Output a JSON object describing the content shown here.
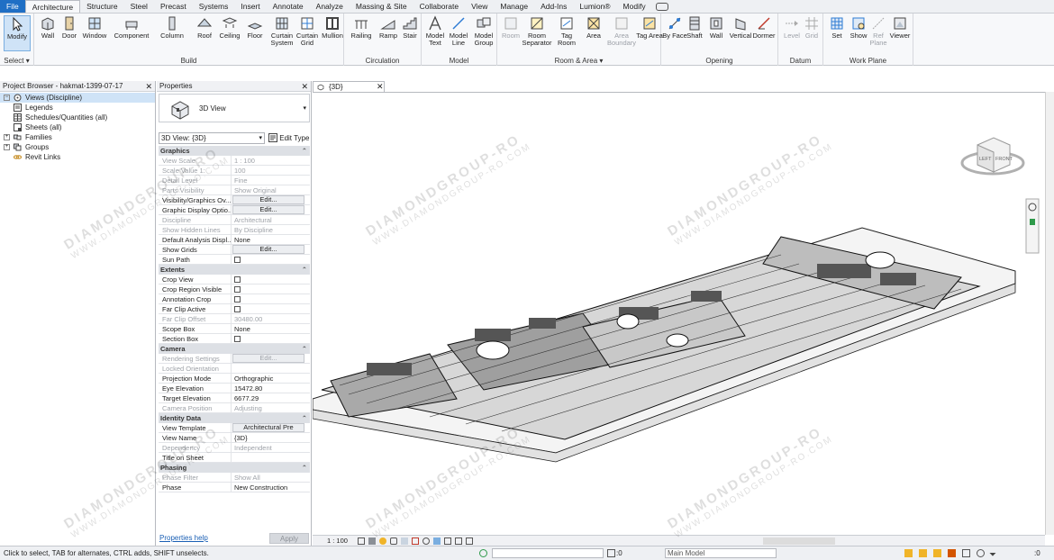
{
  "ribbon_tabs": [
    "File",
    "Architecture",
    "Structure",
    "Steel",
    "Precast",
    "Systems",
    "Insert",
    "Annotate",
    "Analyze",
    "Massing & Site",
    "Collaborate",
    "View",
    "Manage",
    "Add-Ins",
    "Lumion®",
    "Modify"
  ],
  "active_tab": "Architecture",
  "ribbon": {
    "select_label": "Select ▾",
    "groups": {
      "build": "Build",
      "circulation": "Circulation",
      "model": "Model",
      "room_area": "Room & Area ▾",
      "opening": "Opening",
      "datum": "Datum",
      "work_plane": "Work Plane"
    },
    "tools": {
      "modify": "Modify",
      "wall": "Wall",
      "door": "Door",
      "window": "Window",
      "component": "Component",
      "column": "Column",
      "roof": "Roof",
      "ceiling": "Ceiling",
      "floor": "Floor",
      "curtain_system": "Curtain System",
      "curtain_grid": "Curtain Grid",
      "mullion": "Mullion",
      "railing": "Railing",
      "ramp": "Ramp",
      "stair": "Stair",
      "model_text": "Model Text",
      "model_line": "Model Line",
      "model_group": "Model Group",
      "room": "Room",
      "room_separator": "Room Separator",
      "tag_room": "Tag Room",
      "area": "Area",
      "area_boundary": "Area Boundary",
      "tag_area": "Tag Area",
      "by_face": "By Face",
      "shaft": "Shaft",
      "wall_opening": "Wall",
      "vertical": "Vertical",
      "dormer": "Dormer",
      "level": "Level",
      "grid": "Grid",
      "set": "Set",
      "show": "Show",
      "ref_plane": "Ref Plane",
      "viewer": "Viewer"
    }
  },
  "project_browser": {
    "title": "Project Browser - hakmat-1399-07-17",
    "items": [
      {
        "label": "Views (Discipline)",
        "expanded": true
      },
      {
        "label": "Legends"
      },
      {
        "label": "Schedules/Quantities (all)"
      },
      {
        "label": "Sheets (all)"
      },
      {
        "label": "Families"
      },
      {
        "label": "Groups"
      },
      {
        "label": "Revit Links"
      }
    ]
  },
  "properties": {
    "title": "Properties",
    "type_name": "3D View",
    "instance_selector": "3D View: {3D}",
    "edit_type": "Edit Type",
    "sections": {
      "graphics": "Graphics",
      "extents": "Extents",
      "camera": "Camera",
      "identity": "Identity Data",
      "phasing": "Phasing"
    },
    "rows": {
      "view_scale": {
        "k": "View Scale",
        "v": "1 : 100"
      },
      "scale_value": {
        "k": "Scale Value    1:",
        "v": "100"
      },
      "detail_level": {
        "k": "Detail Level",
        "v": "Fine"
      },
      "parts_visibility": {
        "k": "Parts Visibility",
        "v": "Show Original"
      },
      "vis_graphics": {
        "k": "Visibility/Graphics Ov...",
        "v": "Edit..."
      },
      "graphic_display": {
        "k": "Graphic Display Optio...",
        "v": "Edit..."
      },
      "discipline": {
        "k": "Discipline",
        "v": "Architectural"
      },
      "hidden_lines": {
        "k": "Show Hidden Lines",
        "v": "By Discipline"
      },
      "analysis_display": {
        "k": "Default Analysis Displ...",
        "v": "None"
      },
      "show_grids": {
        "k": "Show Grids",
        "v": "Edit..."
      },
      "sun_path": {
        "k": "Sun Path"
      },
      "crop_view": {
        "k": "Crop View"
      },
      "crop_region": {
        "k": "Crop Region Visible"
      },
      "annotation_crop": {
        "k": "Annotation Crop"
      },
      "far_clip_active": {
        "k": "Far Clip Active"
      },
      "far_clip_offset": {
        "k": "Far Clip Offset",
        "v": "30480.00"
      },
      "scope_box": {
        "k": "Scope Box",
        "v": "None"
      },
      "section_box": {
        "k": "Section Box"
      },
      "rendering": {
        "k": "Rendering Settings",
        "v": "Edit..."
      },
      "locked_orient": {
        "k": "Locked Orientation",
        "v": ""
      },
      "projection": {
        "k": "Projection Mode",
        "v": "Orthographic"
      },
      "eye_elev": {
        "k": "Eye Elevation",
        "v": "15472.80"
      },
      "target_elev": {
        "k": "Target Elevation",
        "v": "6677.29"
      },
      "camera_pos": {
        "k": "Camera Position",
        "v": "Adjusting"
      },
      "view_template": {
        "k": "View Template",
        "v": "Architectural Pre"
      },
      "view_name": {
        "k": "View Name",
        "v": "{3D}"
      },
      "dependency": {
        "k": "Dependency",
        "v": "Independent"
      },
      "title_on_sheet": {
        "k": "Title on Sheet",
        "v": ""
      },
      "phase_filter": {
        "k": "Phase Filter",
        "v": "Show All"
      },
      "phase": {
        "k": "Phase",
        "v": "New Construction"
      }
    },
    "help_link": "Properties help",
    "apply": "Apply"
  },
  "view": {
    "tab_label": "{3D}",
    "scale": "1 : 100",
    "viewcube_left": "LEFT",
    "viewcube_front": "FRONT"
  },
  "status_bar": {
    "hint": "Click to select, TAB for alternates, CTRL adds, SHIFT unselects.",
    "count1": ":0",
    "model": "Main Model",
    "count2": ":0"
  },
  "watermark": {
    "big": "DIAMONDGROUP-RO",
    "small": "WWW.DIAMONDGROUP-RO.COM"
  },
  "colors": {
    "file_tab": "#1f6fc5",
    "accent": "#2d7bd4",
    "highlight": "#cfe3f7"
  }
}
